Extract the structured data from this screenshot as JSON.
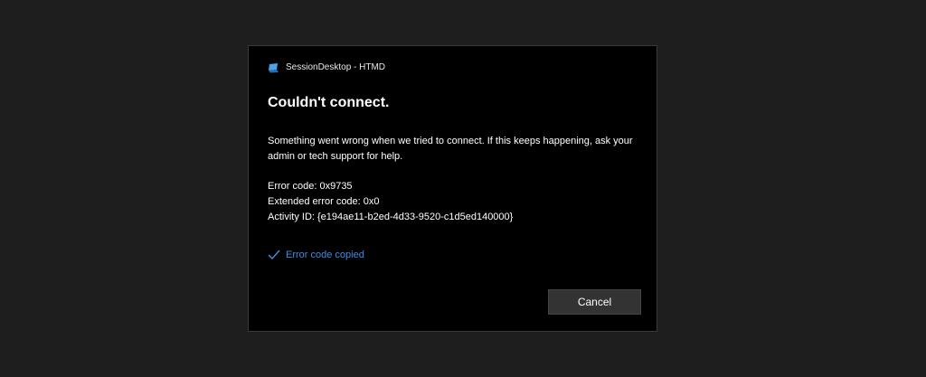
{
  "dialog": {
    "app_title": "SessionDesktop - HTMD",
    "app_icon": "remote-desktop-icon",
    "heading": "Couldn't connect.",
    "message": "Something went wrong when we tried to connect. If this keeps happening, ask your admin or tech support for help.",
    "error_code": "Error code: 0x9735",
    "extended_error_code": "Extended error code: 0x0",
    "activity_id": "Activity ID: {e194ae11-b2ed-4d33-9520-c1d5ed140000}",
    "copied_status": "Error code copied",
    "copied_icon": "checkmark-icon",
    "cancel_label": "Cancel"
  },
  "colors": {
    "background": "#1e1e1e",
    "dialog_bg": "#000000",
    "accent": "#3d8ee6",
    "button_bg": "#333333"
  }
}
